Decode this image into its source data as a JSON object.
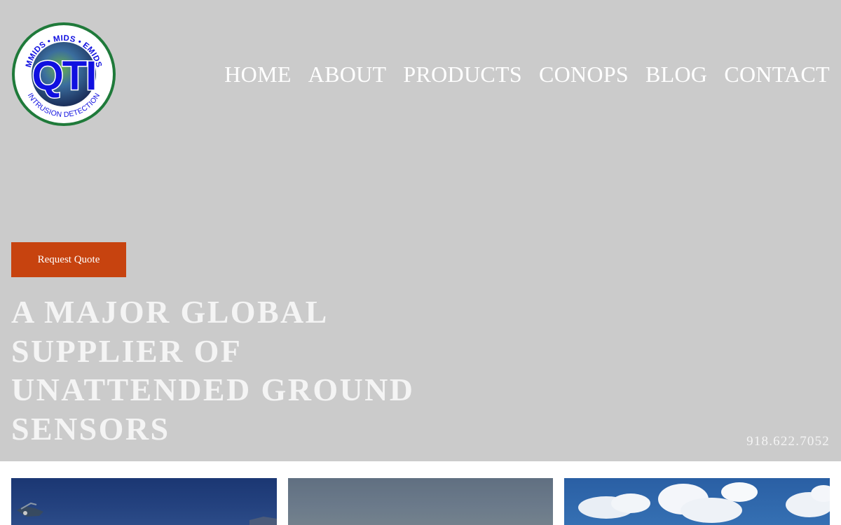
{
  "logo": {
    "top_text": "MMIDS • MIDS • EMIDS",
    "brand": "QTI",
    "bottom_text": "INTRUSION DETECTION"
  },
  "nav": {
    "items": [
      {
        "label": "HOME"
      },
      {
        "label": "ABOUT"
      },
      {
        "label": "PRODUCTS"
      },
      {
        "label": "CONOPS"
      },
      {
        "label": "BLOG"
      },
      {
        "label": "CONTACT"
      }
    ]
  },
  "hero": {
    "cta_label": "Request Quote",
    "headline": "A MAJOR GLOBAL SUPPLIER OF UNATTENDED GROUND SENSORS",
    "phone": "918.622.7052"
  },
  "colors": {
    "hero_bg": "#cbcbcb",
    "accent": "#c7430f",
    "logo_blue": "#1010e0",
    "logo_green": "#1f7a3a"
  }
}
